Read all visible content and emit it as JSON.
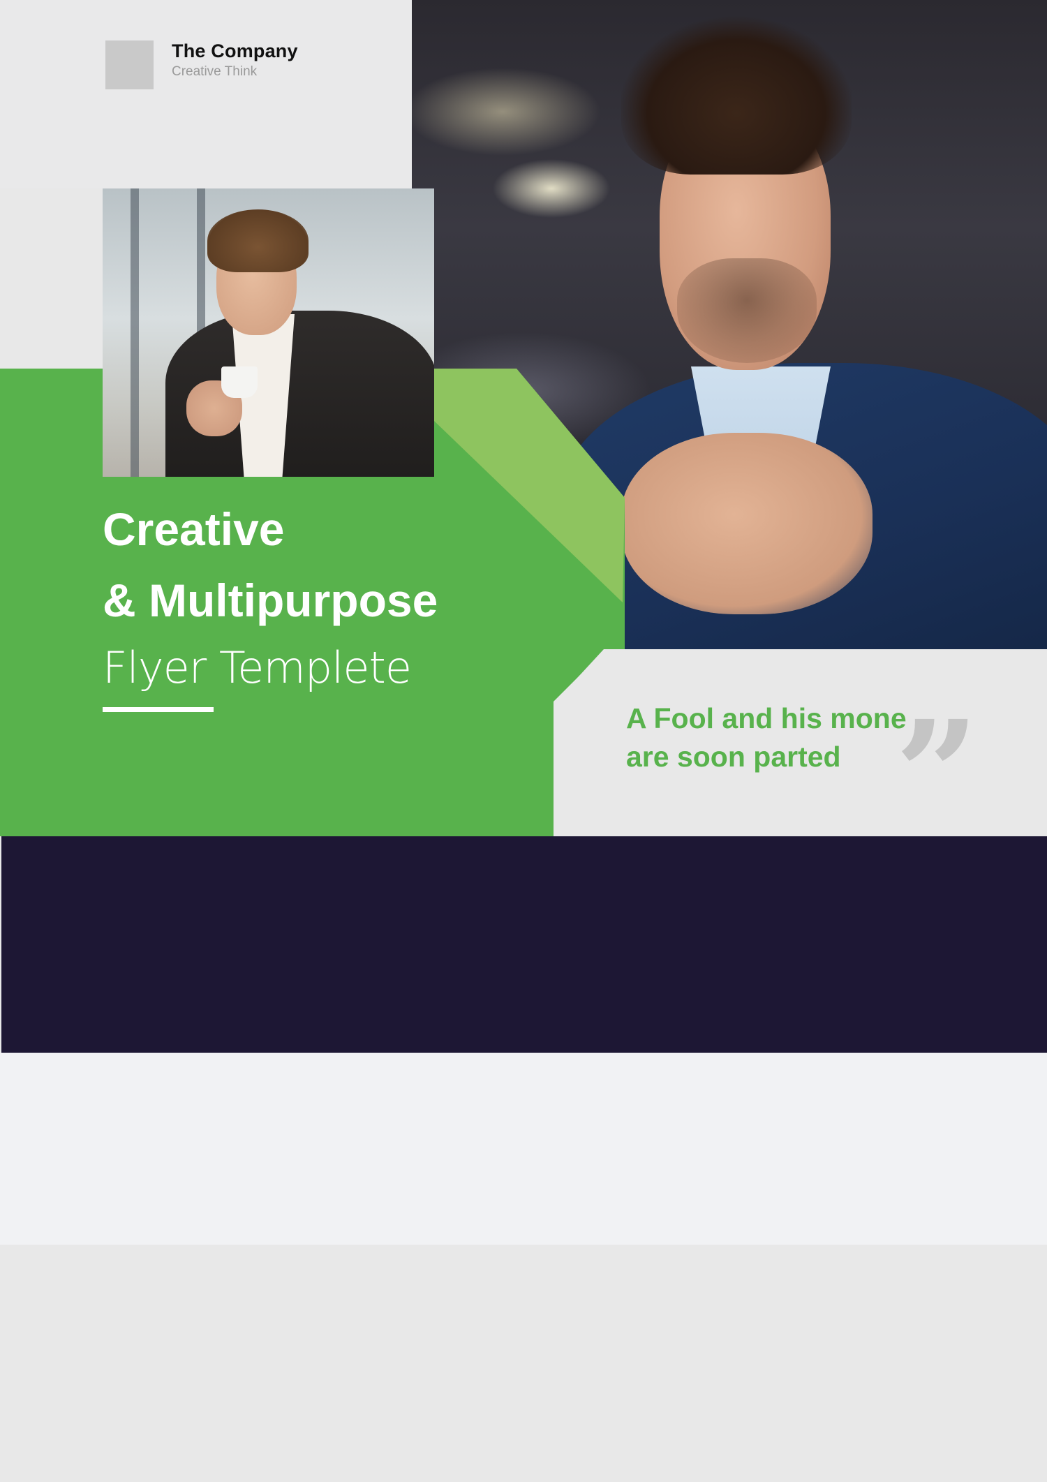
{
  "brand": {
    "company_name": "The Company",
    "tagline": "Creative Think"
  },
  "headline": {
    "line1": "Creative",
    "line2": "& Multipurpose",
    "line3": "Flyer Templete"
  },
  "quote": {
    "text": "A Fool and his mone are soon parted",
    "mark": "”"
  },
  "colors": {
    "green": "#58b24c",
    "light_green": "#8ec45f",
    "navy": "#1d1734",
    "panel_grey": "#e9e9ea",
    "page_grey": "#e8e8e8",
    "quote_mark_grey": "#c4c4c4"
  },
  "images": {
    "hero": "man-adjusting-tie-photo",
    "inset": "smiling-man-with-coffee-cup-photo",
    "logo": "grey-square-logo-placeholder"
  }
}
